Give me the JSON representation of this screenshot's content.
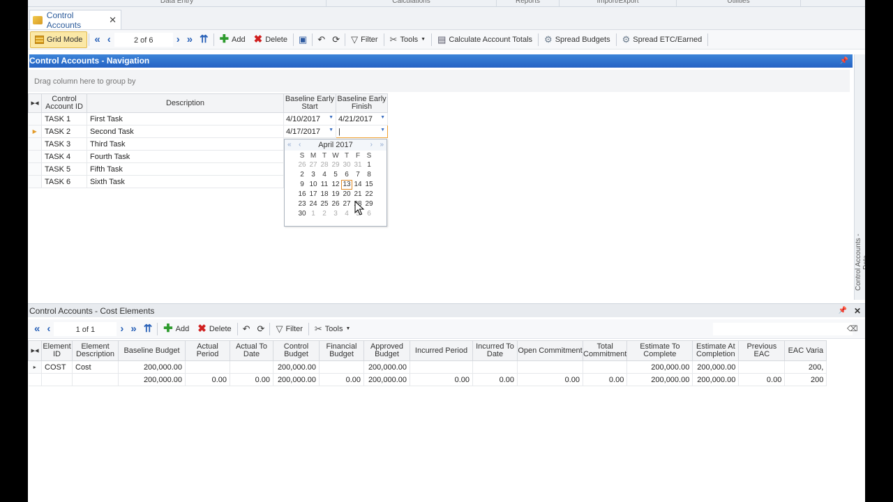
{
  "ribbon": {
    "tabs": [
      "Data Entry",
      "Calculations",
      "Reports",
      "Import/Export",
      "Utilities"
    ]
  },
  "doc_tab": {
    "label": "Control Accounts"
  },
  "toolbar": {
    "grid_mode": "Grid Mode",
    "pager": "2 of 6",
    "add": "Add",
    "delete": "Delete",
    "filter": "Filter",
    "tools": "Tools",
    "calc_totals": "Calculate Account Totals",
    "spread_budgets": "Spread Budgets",
    "spread_etc": "Spread ETC/Earned"
  },
  "nav_panel": {
    "title": "Control Accounts - Navigation",
    "drag_hint": "Drag column here to group by",
    "side_label": "Control Accounts - Data",
    "columns": [
      "Control Account ID",
      "Description",
      "Baseline Early Start",
      "Baseline Early Finish"
    ],
    "rows": [
      {
        "id": "TASK 1",
        "desc": "First Task",
        "start": "4/10/2017",
        "finish": "4/21/2017"
      },
      {
        "id": "TASK 2",
        "desc": "Second Task",
        "start": "4/17/2017",
        "finish": "|"
      },
      {
        "id": "TASK 3",
        "desc": "Third Task",
        "start": "",
        "finish": ""
      },
      {
        "id": "TASK 4",
        "desc": "Fourth Task",
        "start": "",
        "finish": ""
      },
      {
        "id": "TASK 5",
        "desc": "Fifth Task",
        "start": "",
        "finish": ""
      },
      {
        "id": "TASK 6",
        "desc": "Sixth Task",
        "start": "",
        "finish": ""
      }
    ]
  },
  "calendar": {
    "month": "April 2017",
    "weekdays": [
      "S",
      "M",
      "T",
      "W",
      "T",
      "F",
      "S"
    ],
    "weeks": [
      [
        "26",
        "27",
        "28",
        "29",
        "30",
        "31",
        "1"
      ],
      [
        "2",
        "3",
        "4",
        "5",
        "6",
        "7",
        "8"
      ],
      [
        "9",
        "10",
        "11",
        "12",
        "13",
        "14",
        "15"
      ],
      [
        "16",
        "17",
        "18",
        "19",
        "20",
        "21",
        "22"
      ],
      [
        "23",
        "24",
        "25",
        "26",
        "27",
        "28",
        "29"
      ],
      [
        "30",
        "1",
        "2",
        "3",
        "4",
        "5",
        "6"
      ]
    ],
    "today": "13"
  },
  "cost_panel": {
    "title": "Control Accounts - Cost Elements",
    "toolbar": {
      "pager": "1 of 1",
      "add": "Add",
      "delete": "Delete",
      "filter": "Filter",
      "tools": "Tools"
    },
    "columns": [
      "Element ID",
      "Element Description",
      "Baseline Budget",
      "Actual Period",
      "Actual To Date",
      "Control Budget",
      "Financial Budget",
      "Approved Budget",
      "Incurred Period",
      "Incurred To Date",
      "Open Commitment",
      "Total Commitment",
      "Estimate To Complete",
      "Estimate At Completion",
      "Previous EAC",
      "EAC Varia"
    ],
    "rows": [
      [
        "COST",
        "Cost",
        "200,000.00",
        "",
        "",
        "200,000.00",
        "",
        "200,000.00",
        "",
        "",
        "",
        "",
        "200,000.00",
        "200,000.00",
        "",
        "200,"
      ]
    ],
    "totals": [
      "",
      "",
      "200,000.00",
      "0.00",
      "0.00",
      "200,000.00",
      "0.00",
      "200,000.00",
      "0.00",
      "0.00",
      "0.00",
      "0.00",
      "200,000.00",
      "200,000.00",
      "0.00",
      "200"
    ]
  }
}
